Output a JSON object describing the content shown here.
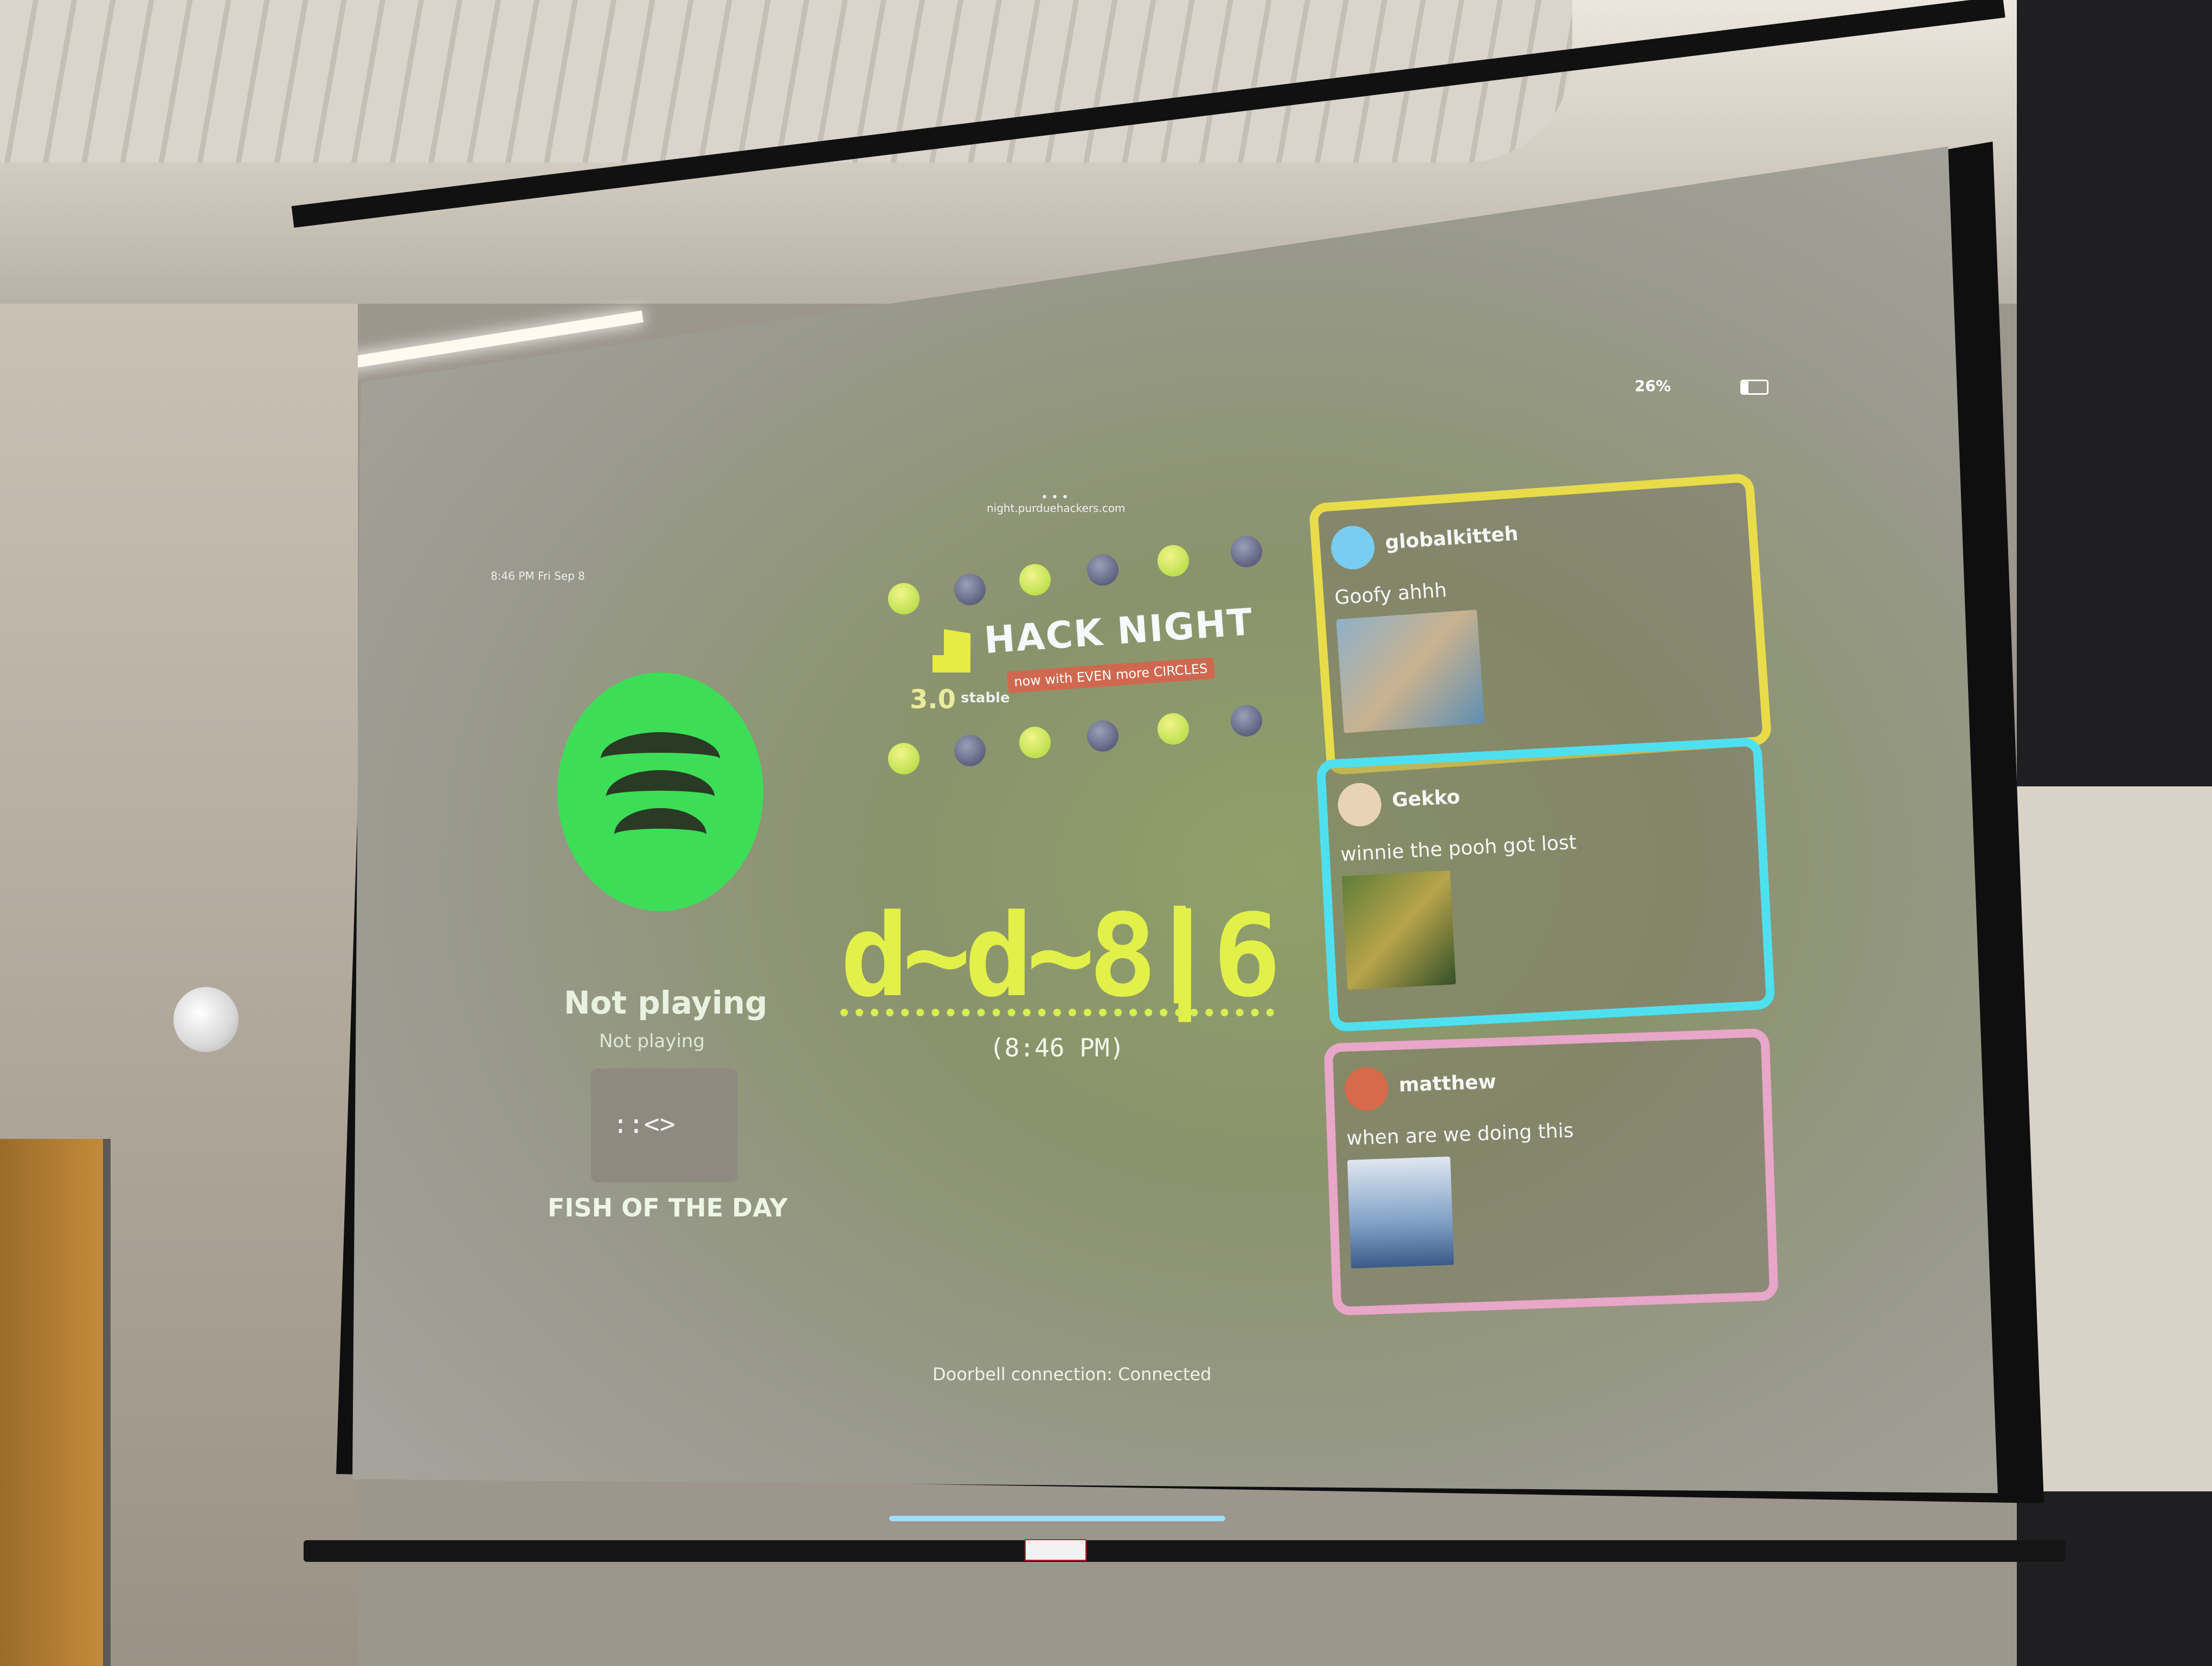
{
  "browser": {
    "url": "night.purduehackers.com",
    "status_left": "8:46 PM  Fri Sep 8",
    "status_right": "26%"
  },
  "now_playing": {
    "icon": "spotify-logo",
    "title": "Not playing",
    "subtitle": "Not playing",
    "accent": "#3ddd58"
  },
  "fish": {
    "glyph": "::<>",
    "label": "FISH OF THE DAY"
  },
  "hack_night": {
    "title": "HACK NIGHT",
    "version": "3.0",
    "channel": "stable",
    "tagline": "now with EVEN more CIRCLES"
  },
  "clock": {
    "display": "d~d~8|6",
    "time": "(8:46 PM)",
    "color": "#e2f04a"
  },
  "posts": [
    {
      "user": "globalkitteh",
      "message": "Goofy ahhh",
      "border": "#e8dc4a"
    },
    {
      "user": "Gekko",
      "message": "winnie the pooh got lost",
      "border": "#4fe0f0"
    },
    {
      "user": "matthew",
      "message": "when are we doing this",
      "border": "#e8a6c8"
    }
  ],
  "footer": {
    "doorbell": "Doorbell connection: Connected"
  }
}
